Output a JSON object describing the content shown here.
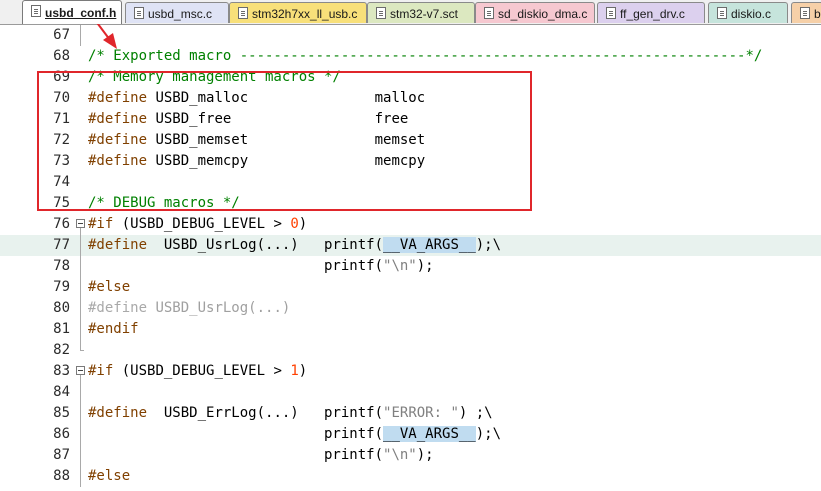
{
  "tabs": [
    {
      "label": "usbd_conf.h",
      "active": true
    },
    {
      "label": "usbd_msc.c"
    },
    {
      "label": "stm32h7xx_ll_usb.c"
    },
    {
      "label": "stm32-v7.sct"
    },
    {
      "label": "sd_diskio_dma.c"
    },
    {
      "label": "ff_gen_drv.c"
    },
    {
      "label": "diskio.c"
    },
    {
      "label": "b"
    }
  ],
  "tab_colors": {
    "active": "#ffffff",
    "usbd_msc.c": "#dfe3f5",
    "stm32h7xx_ll_usb.c": "#f8e07a",
    "stm32-v7.sct": "#dce8c0",
    "sd_diskio_dma.c": "#f6c8d0",
    "ff_gen_drv.c": "#dcd0ee",
    "diskio.c": "#c6e4dc",
    "b": "#f6d0a8"
  },
  "lines": [
    {
      "num": "67",
      "comment": "",
      "pp": "",
      "a": "",
      "num_lit": "",
      "b": "",
      "str": "",
      "c": "",
      "d": "",
      "e": ""
    },
    {
      "num": "68",
      "comment": "/* Exported macro ------------------------------------------------------------*/"
    },
    {
      "num": "69",
      "comment": "/* Memory management macros */"
    },
    {
      "num": "70",
      "pp": "#define",
      "a": " USBD_malloc               malloc"
    },
    {
      "num": "71",
      "pp": "#define",
      "a": " USBD_free                 free"
    },
    {
      "num": "72",
      "pp": "#define",
      "a": " USBD_memset               memset"
    },
    {
      "num": "73",
      "pp": "#define",
      "a": " USBD_memcpy               memcpy"
    },
    {
      "num": "74"
    },
    {
      "num": "75",
      "comment": "/* DEBUG macros */"
    },
    {
      "num": "76",
      "pp": "#if",
      "a": " (USBD_DEBUG_LEVEL > ",
      "num_lit": "0",
      "b": ")"
    },
    {
      "num": "77",
      "pp": "#define",
      "a": "  USBD_UsrLog(...)   printf(",
      "va": "__VA_ARGS__",
      "c": ");\\"
    },
    {
      "num": "78",
      "a": "                            printf(",
      "str": "\"\\n\"",
      "c": ");"
    },
    {
      "num": "79",
      "pp": "#else"
    },
    {
      "num": "80",
      "dim_pp": "#define",
      "dim": " USBD_UsrLog(...)"
    },
    {
      "num": "81",
      "pp": "#endif"
    },
    {
      "num": "82"
    },
    {
      "num": "83",
      "pp": "#if",
      "a": " (USBD_DEBUG_LEVEL > ",
      "num_lit": "1",
      "b": ")"
    },
    {
      "num": "84"
    },
    {
      "num": "85",
      "pp": "#define",
      "a": "  USBD_ErrLog(...)   printf(",
      "str": "\"ERROR: \"",
      "c": ") ;\\"
    },
    {
      "num": "86",
      "a": "                            printf(",
      "va": "__VA_ARGS__",
      "c": ");\\"
    },
    {
      "num": "87",
      "a": "                            printf(",
      "str": "\"\\n\"",
      "c": ");"
    },
    {
      "num": "88",
      "pp": "#else"
    }
  ],
  "annotation": {
    "box_color": "#e0262b",
    "arrow_color": "#e0262b"
  },
  "icons": {
    "tab_file": "document-icon",
    "fold_open": "fold-minus-icon"
  }
}
